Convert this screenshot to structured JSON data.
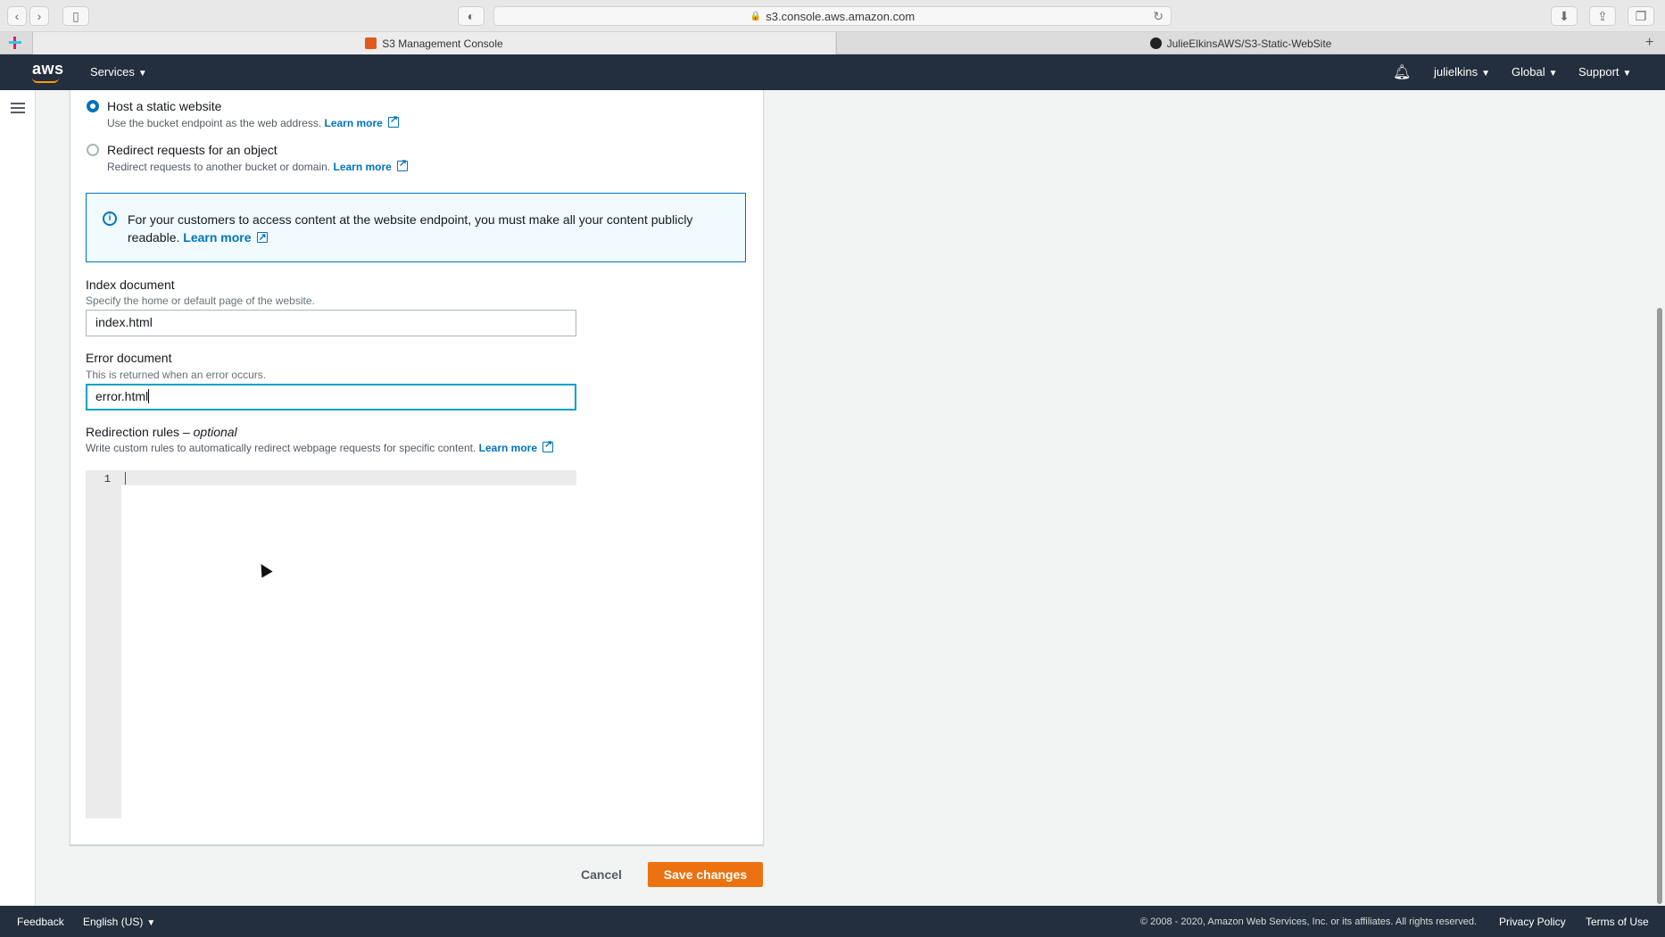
{
  "browser": {
    "url": "s3.console.aws.amazon.com",
    "tabs": [
      {
        "label": "S3 Management Console",
        "active": true
      },
      {
        "label": "JulieElkinsAWS/S3-Static-WebSite",
        "active": false
      }
    ]
  },
  "aws_nav": {
    "logo": "aws",
    "services_label": "Services",
    "user_label": "julielkins",
    "region_label": "Global",
    "support_label": "Support",
    "bar_color": "#232f3e"
  },
  "hosting_type": {
    "options": [
      {
        "label": "Host a static website",
        "description": "Use the bucket endpoint as the web address.",
        "link": "Learn more",
        "selected": true
      },
      {
        "label": "Redirect requests for an object",
        "description": "Redirect requests to another bucket or domain.",
        "link": "Learn more",
        "selected": false
      }
    ]
  },
  "info_alert": {
    "text": "For your customers to access content at the website endpoint, you must make all your content publicly readable.",
    "link": "Learn more"
  },
  "index_document": {
    "label": "Index document",
    "description": "Specify the home or default page of the website.",
    "value": "index.html"
  },
  "error_document": {
    "label": "Error document",
    "description": "This is returned when an error occurs.",
    "value": "error.html"
  },
  "redirection_rules": {
    "label": "Redirection rules –",
    "label_optional": "optional",
    "description": "Write custom rules to automatically redirect webpage requests for specific content.",
    "link": "Learn more",
    "line_number": "1"
  },
  "actions": {
    "cancel_label": "Cancel",
    "save_label": "Save changes",
    "save_color": "#ec7211"
  },
  "footer": {
    "feedback": "Feedback",
    "language": "English (US)",
    "copyright": "© 2008 - 2020, Amazon Web Services, Inc. or its affiliates. All rights reserved.",
    "privacy": "Privacy Policy",
    "terms": "Terms of Use"
  }
}
